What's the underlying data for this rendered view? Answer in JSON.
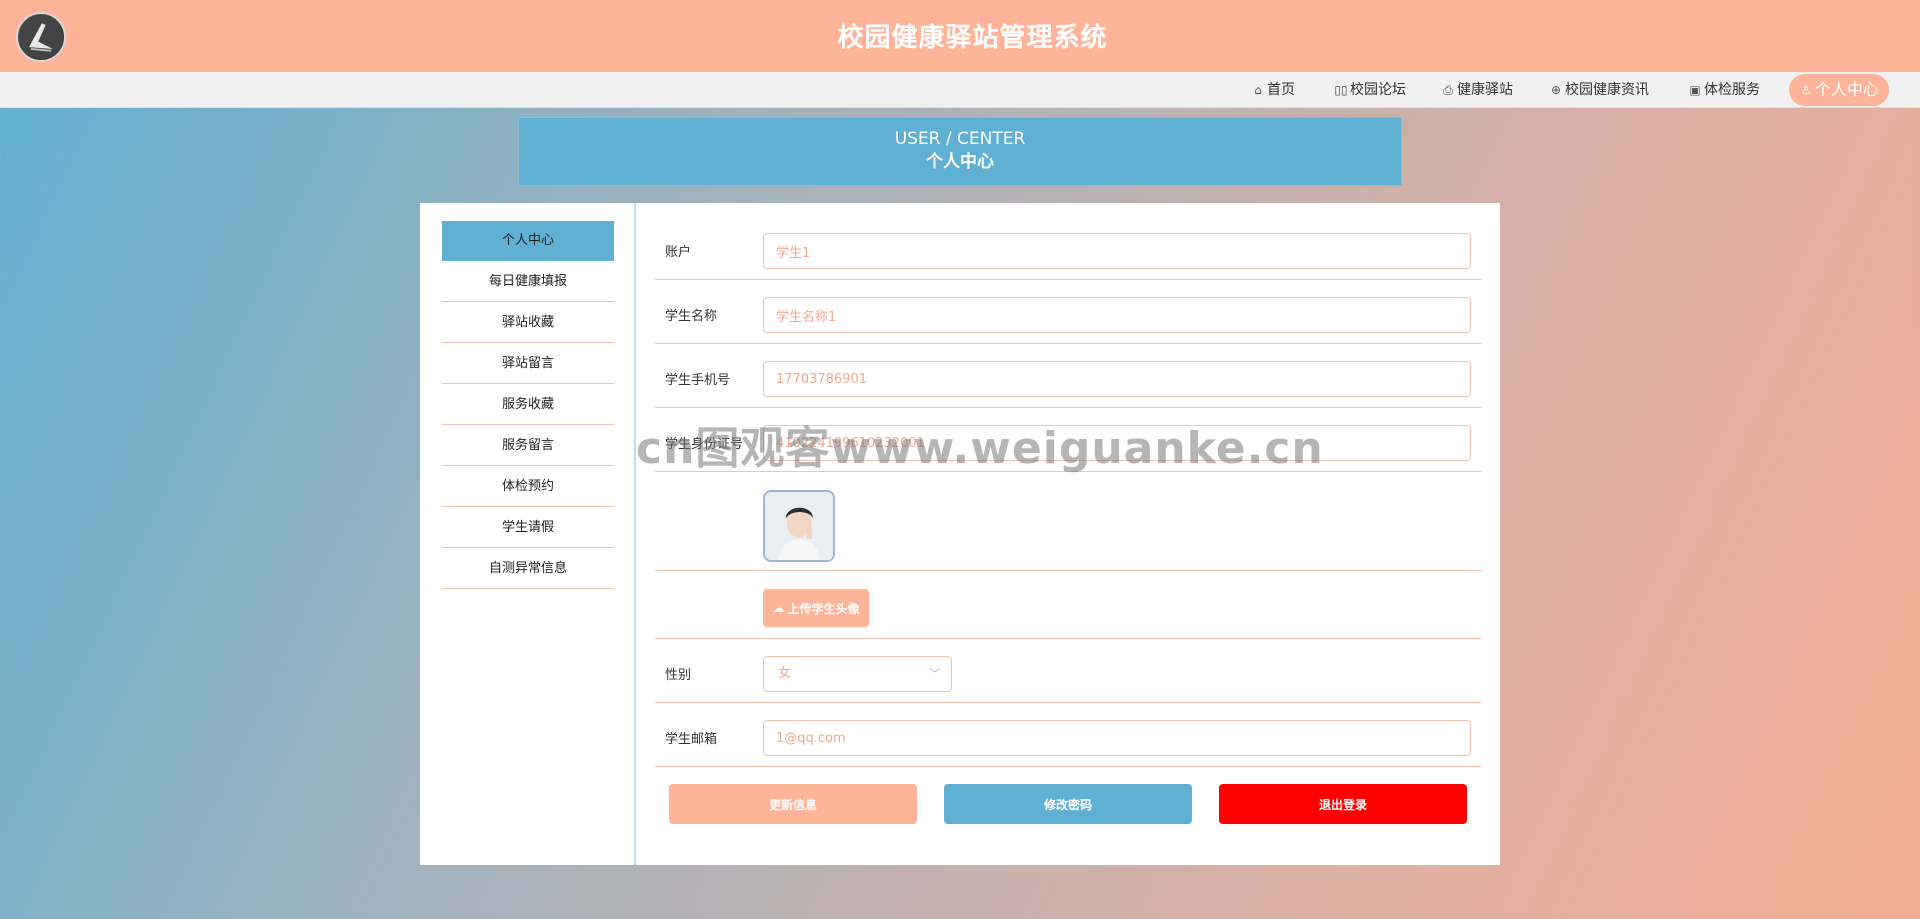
{
  "header": {
    "title": "校园健康驿站管理系统",
    "logo_icon": "logo-icon"
  },
  "nav": {
    "items": [
      {
        "label": "首页",
        "icon": "home-icon"
      },
      {
        "label": "校园论坛",
        "icon": "forum-icon"
      },
      {
        "label": "健康驿站",
        "icon": "station-icon"
      },
      {
        "label": "校园健康资讯",
        "icon": "globe-icon"
      },
      {
        "label": "体检服务",
        "icon": "service-icon"
      },
      {
        "label": "个人中心",
        "icon": "user-icon",
        "active": true
      }
    ]
  },
  "banner": {
    "en": "USER / CENTER",
    "cn": "个人中心"
  },
  "sidebar": {
    "items": [
      {
        "label": "个人中心",
        "active": true
      },
      {
        "label": "每日健康填报"
      },
      {
        "label": "驿站收藏"
      },
      {
        "label": "驿站留言"
      },
      {
        "label": "服务收藏"
      },
      {
        "label": "服务留言"
      },
      {
        "label": "体检预约"
      },
      {
        "label": "学生请假"
      },
      {
        "label": "自测异常信息"
      }
    ]
  },
  "form": {
    "account": {
      "label": "账户",
      "value": "学生1"
    },
    "name": {
      "label": "学生名称",
      "value": "学生名称1"
    },
    "phone": {
      "label": "学生手机号",
      "value": "17703786901"
    },
    "idcard": {
      "label": "学生身份证号",
      "value": "410224199610232001"
    },
    "upload_label": "上传学生头像",
    "gender": {
      "label": "性别",
      "value": "女"
    },
    "email": {
      "label": "学生邮箱",
      "value": "1@qq.com"
    }
  },
  "actions": {
    "update": "更新信息",
    "password": "修改密码",
    "logout": "退出登录"
  },
  "colors": {
    "primary": "#ffb399",
    "secondary": "#5fb0d2",
    "danger": "#ff0000"
  },
  "watermark": "cn图观客www.weiguanke.cn"
}
